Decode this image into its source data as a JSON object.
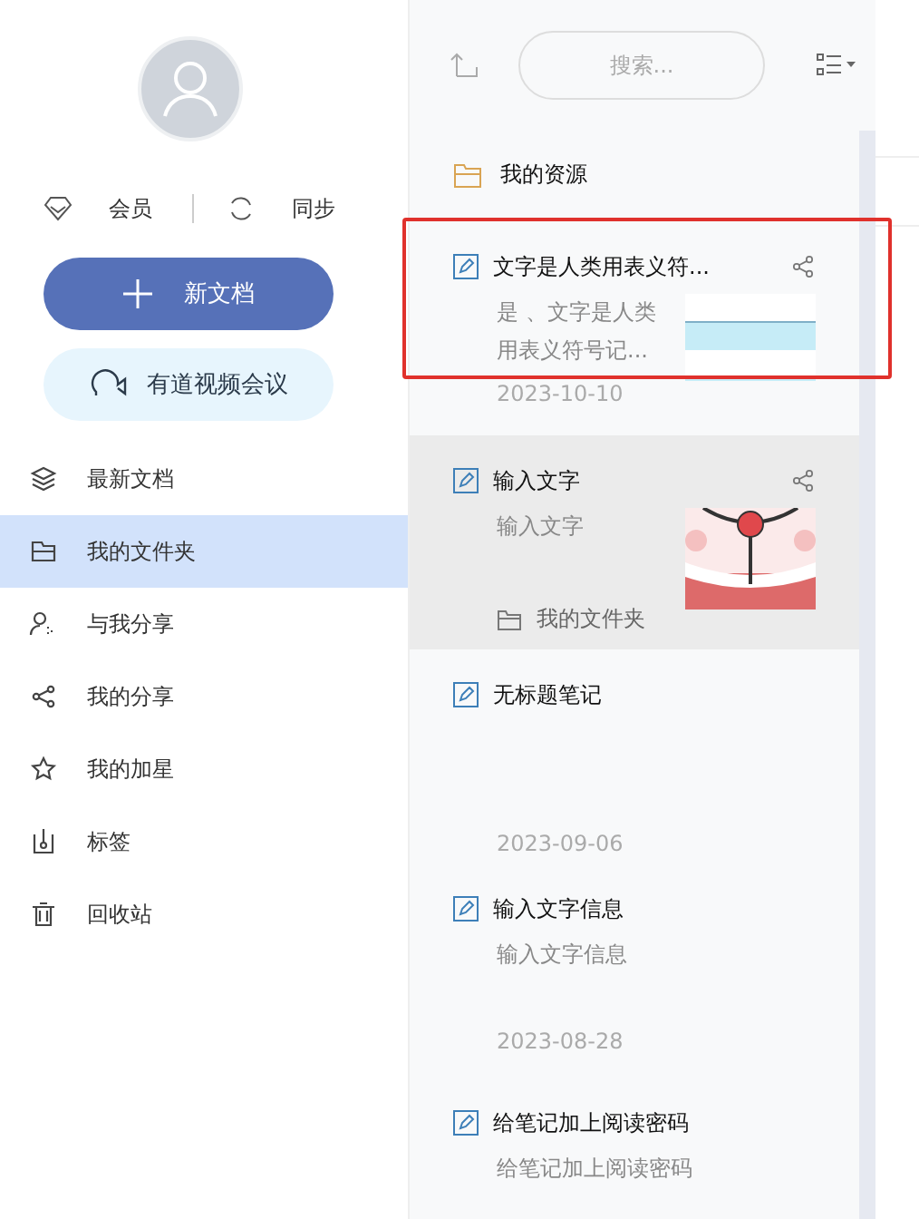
{
  "sidebar": {
    "account": {
      "member": "会员",
      "sync": "同步"
    },
    "new_button": "新文档",
    "meeting_button": "有道视频会议",
    "items": [
      {
        "label": "最新文档",
        "selected": false
      },
      {
        "label": "我的文件夹",
        "selected": true
      },
      {
        "label": "与我分享",
        "selected": false
      },
      {
        "label": "我的分享",
        "selected": false
      },
      {
        "label": "我的加星",
        "selected": false
      },
      {
        "label": "标签",
        "selected": false
      },
      {
        "label": "回收站",
        "selected": false
      }
    ]
  },
  "search": {
    "placeholder": "搜索..."
  },
  "list": [
    {
      "kind": "folder",
      "title": "我的资源"
    },
    {
      "kind": "note",
      "title": "文字是人类用表义符...",
      "snippet": [
        "是 、文字是人类",
        "用表义符号记..."
      ],
      "date": "2023-10-10",
      "thumbnail": {
        "kind": "picture"
      },
      "shared": true,
      "selected": false,
      "highlighted": true
    },
    {
      "kind": "note",
      "title": "输入文字",
      "snippet": [
        "输入文字"
      ],
      "folder": "我的文件夹",
      "thumbnail": {
        "kind": "picture"
      },
      "shared": true,
      "selected": true,
      "highlighted": false
    },
    {
      "kind": "note",
      "title": "无标题笔记",
      "date": "2023-09-06",
      "shared": false,
      "selected": false,
      "highlighted": false
    },
    {
      "kind": "note",
      "title": "输入文字信息",
      "snippet": [
        "输入文字信息"
      ],
      "date": "2023-08-28",
      "shared": false,
      "selected": false,
      "highlighted": false
    },
    {
      "kind": "note",
      "title": "给笔记加上阅读密码",
      "snippet": [
        "给笔记加上阅读密码"
      ],
      "shared": false,
      "selected": false,
      "highlighted": false
    }
  ]
}
